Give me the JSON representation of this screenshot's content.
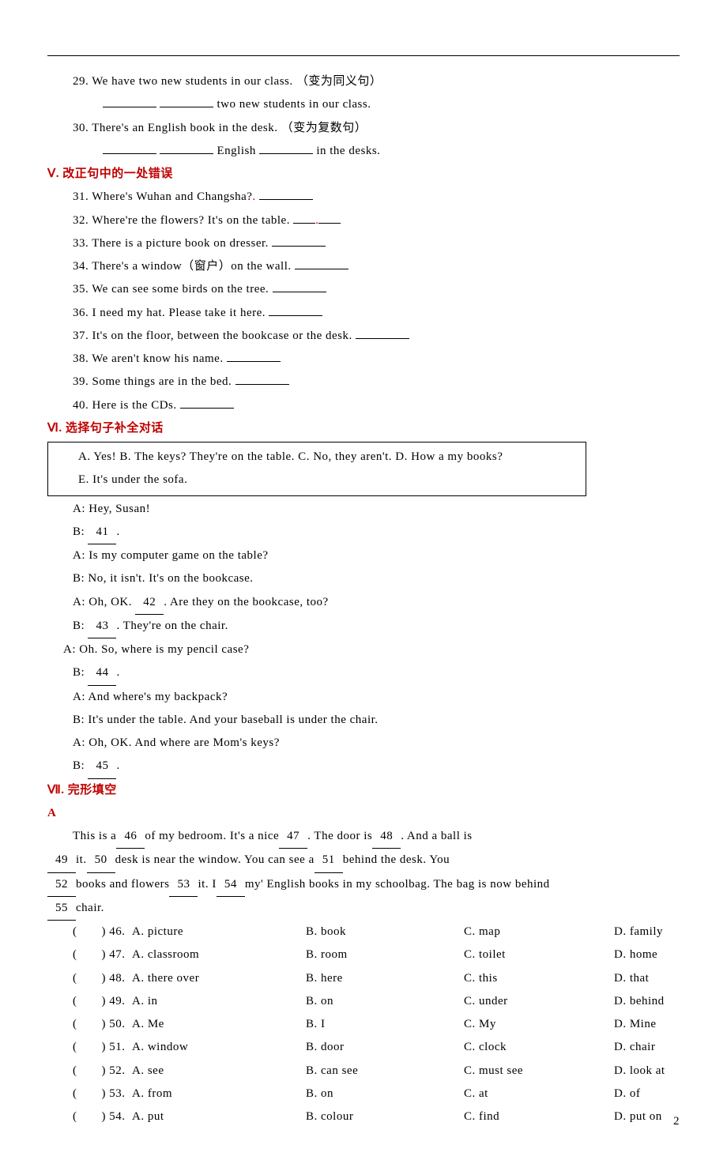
{
  "lines": {
    "q29a": "29. We have two new students in our class. （变为同义句）",
    "q29b_tail": " two new students in our class.",
    "q30a": "30. There's an English book in the desk. （变为复数句）",
    "q30b_mid1": " English ",
    "q30b_tail": " in the desks.",
    "sec5": "Ⅴ. 改正句中的一处错误",
    "q31": "31. Where's Wuhan and Changsha?",
    "q32": "32. Where're the flowers? It's on the table. ",
    "q33": "33. There is a picture book on dresser. ",
    "q34": "34. There's a window（窗户）on the wall. ",
    "q35": "35. We can see some birds on the tree. ",
    "q36": "36. I need my hat. Please take it here. ",
    "q37": "37. It's on the floor, between the bookcase or the desk. ",
    "q38": "38. We aren't know his name. ",
    "q39": "39. Some things are in the bed. ",
    "q40": "40. Here is the CDs. ",
    "sec6": "Ⅵ. 选择句子补全对话",
    "box1": "A. Yes!  B. The keys? They're on the table.  C. No, they aren't.  D. How a my books?",
    "box2": "E. It's under the sofa.",
    "d1": "A: Hey, Susan!",
    "d2a": "B: ",
    "d2b": "41",
    "d2c": ".",
    "d3": "A: Is my computer game on the table?",
    "d4": "B: No, it isn't. It's on the bookcase.",
    "d5a": "A: Oh, OK. ",
    "d5b": "42",
    "d5c": ". Are they on the bookcase, too?",
    "d6a": "B: ",
    "d6b": "43",
    "d6c": ". They're on the chair.",
    "d7": "A: Oh. So, where is my pencil case?",
    "d8a": "B: ",
    "d8b": "44",
    "d8c": ".",
    "d9": "A: And where's my backpack?",
    "d10": "B: It's under the table. And your baseball is under the chair.",
    "d11": "A: Oh, OK. And where are Mom's keys?",
    "d12a": "B: ",
    "d12b": "45",
    "d12c": ".",
    "sec7": "Ⅶ. 完形填空",
    "secA": "A",
    "p1a": "This is a",
    "p1_46": "46",
    "p1b": "of my bedroom. It's a nice",
    "p1_47": "47",
    "p1c": ". The door is",
    "p1_48": "48",
    "p1d": ". And a ball is",
    "p2_49": "49",
    "p2a": "it.",
    "p2_50": "50",
    "p2b": "desk is near the window. You can see a",
    "p2_51": "51",
    "p2c": "behind the desk. You",
    "p3_52": "52",
    "p3a": "books and flowers",
    "p3_53": "53",
    "p3b": "it. I",
    "p3_54": "54",
    "p3c": "my' English books in my schoolbag. The bag is now behind",
    "p4_55": "55",
    "p4a": "chair.",
    "paren": "(　　)"
  },
  "opts": [
    {
      "n": "46",
      "a": "A. picture",
      "b": "B. book",
      "c": "C. map",
      "d": "D. family"
    },
    {
      "n": "47",
      "a": "A. classroom",
      "b": "B. room",
      "c": "C. toilet",
      "d": "D. home"
    },
    {
      "n": "48",
      "a": "A. there over",
      "b": "B. here",
      "c": "C. this",
      "d": "D. that"
    },
    {
      "n": "49",
      "a": "A. in",
      "b": "B. on",
      "c": "C. under",
      "d": "D. behind"
    },
    {
      "n": "50",
      "a": "A. Me",
      "b": "B. I",
      "c": "C. My",
      "d": "D. Mine"
    },
    {
      "n": "51",
      "a": "A. window",
      "b": "B. door",
      "c": "C. clock",
      "d": "D. chair"
    },
    {
      "n": "52",
      "a": "A. see",
      "b": "B. can see",
      "c": "C. must see",
      "d": "D. look at"
    },
    {
      "n": "53",
      "a": "A. from",
      "b": "B. on",
      "c": "C. at",
      "d": "D. of"
    },
    {
      "n": "54",
      "a": "A. put",
      "b": "B. colour",
      "c": "C. find",
      "d": "D. put on"
    }
  ],
  "page": "2"
}
